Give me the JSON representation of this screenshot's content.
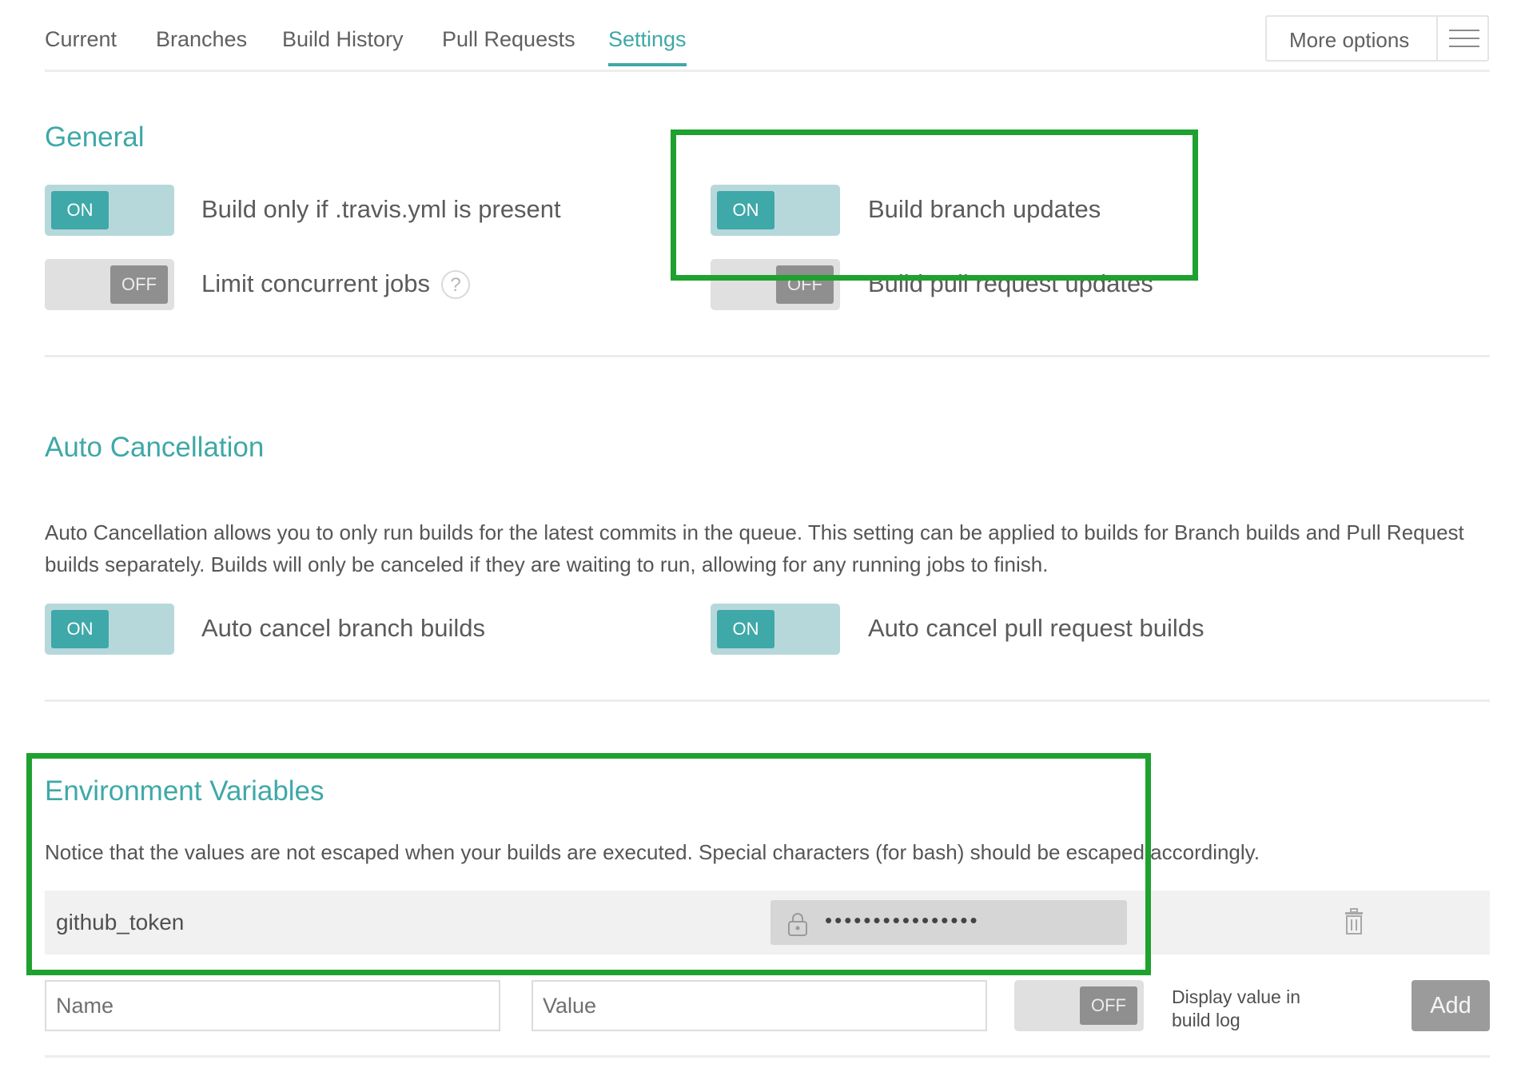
{
  "nav": {
    "tabs": [
      {
        "label": "Current"
      },
      {
        "label": "Branches"
      },
      {
        "label": "Build History"
      },
      {
        "label": "Pull Requests"
      },
      {
        "label": "Settings",
        "active": true
      }
    ],
    "more_options": "More options"
  },
  "general": {
    "title": "General",
    "options": [
      {
        "label": "Build only if .travis.yml is present",
        "state": "ON"
      },
      {
        "label": "Build branch updates",
        "state": "ON"
      },
      {
        "label": "Limit concurrent jobs",
        "state": "OFF",
        "help": "?"
      },
      {
        "label": "Build pull request updates",
        "state": "OFF"
      }
    ]
  },
  "auto_cancel": {
    "title": "Auto Cancellation",
    "description": "Auto Cancellation allows you to only run builds for the latest commits in the queue. This setting can be applied to builds for Branch builds and Pull Request builds separately. Builds will only be canceled if they are waiting to run, allowing for any running jobs to finish.",
    "options": [
      {
        "label": "Auto cancel branch builds",
        "state": "ON"
      },
      {
        "label": "Auto cancel pull request builds",
        "state": "ON"
      }
    ]
  },
  "env_vars": {
    "title": "Environment Variables",
    "notice": "Notice that the values are not escaped when your builds are executed. Special characters (for bash) should be escaped accordingly.",
    "rows": [
      {
        "name": "github_token",
        "value_masked": "••••••••••••••••"
      }
    ],
    "form": {
      "name_placeholder": "Name",
      "value_placeholder": "Value",
      "display_toggle_state": "OFF",
      "display_label": "Display value in build log",
      "add_label": "Add"
    }
  },
  "colors": {
    "accent": "#3fa8a8",
    "toggle_on_track": "#b7d8db",
    "toggle_off_knob": "#8f8f8f",
    "highlight": "#1fa12f"
  },
  "icons": {
    "lock": "lock-icon",
    "trash": "trash-icon",
    "menu": "hamburger-icon",
    "help": "question-icon"
  }
}
